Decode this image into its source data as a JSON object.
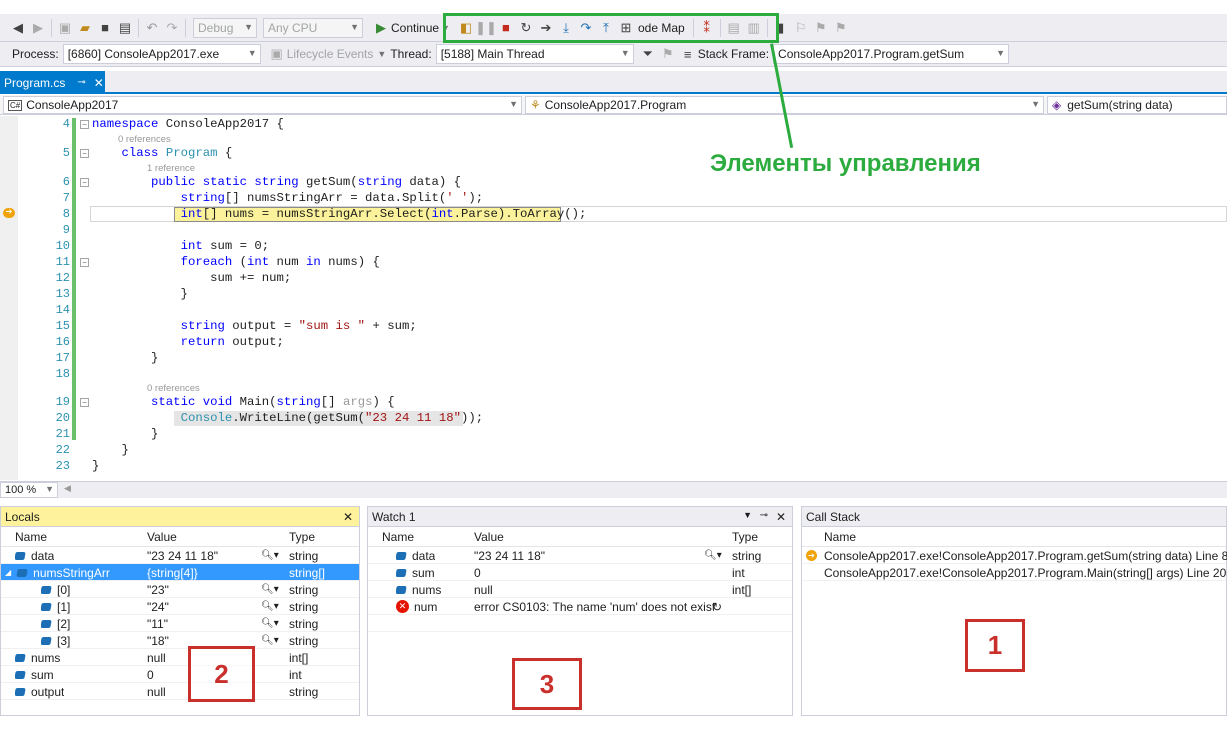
{
  "toolbar1": {
    "config": "Debug",
    "platform": "Any CPU",
    "continue_label": "Continue",
    "code_map_label": "ode Map"
  },
  "toolbar2": {
    "process_label": "Process:",
    "process_value": "[6860] ConsoleApp2017.exe",
    "lifecycle_label": "Lifecycle Events",
    "thread_label": "Thread:",
    "thread_value": "[5188] Main Thread",
    "stack_frame_label": "Stack Frame:",
    "stack_frame_value": "ConsoleApp2017.Program.getSum"
  },
  "tab": {
    "label": "Program.cs"
  },
  "navbar": {
    "project": "ConsoleApp2017",
    "class": "ConsoleApp2017.Program",
    "member": "getSum(string data)"
  },
  "editor": {
    "line_numbers": [
      "4",
      "5",
      "6",
      "7",
      "8",
      "9",
      "10",
      "11",
      "12",
      "13",
      "14",
      "15",
      "16",
      "17",
      "18",
      "19",
      "20",
      "21",
      "22",
      "23"
    ],
    "ref_0_refs_a": "0 references",
    "ref_1_ref": "1 reference",
    "ref_0_refs_b": "0 references"
  },
  "zoom": "100 %",
  "locals": {
    "title": "Locals",
    "headers": [
      "Name",
      "Value",
      "Type"
    ],
    "rows": [
      {
        "name": "data",
        "value": "\"23 24 11 18\"",
        "type": "string"
      },
      {
        "name": "numsStringArr",
        "value": "{string[4]}",
        "type": "string[]"
      },
      {
        "name": "[0]",
        "value": "\"23\"",
        "type": "string"
      },
      {
        "name": "[1]",
        "value": "\"24\"",
        "type": "string"
      },
      {
        "name": "[2]",
        "value": "\"11\"",
        "type": "string"
      },
      {
        "name": "[3]",
        "value": "\"18\"",
        "type": "string"
      },
      {
        "name": "nums",
        "value": "null",
        "type": "int[]"
      },
      {
        "name": "sum",
        "value": "0",
        "type": "int"
      },
      {
        "name": "output",
        "value": "null",
        "type": "string"
      }
    ]
  },
  "watch": {
    "title": "Watch 1",
    "headers": [
      "Name",
      "Value",
      "Type"
    ],
    "rows": [
      {
        "name": "data",
        "value": "\"23 24 11 18\"",
        "type": "string"
      },
      {
        "name": "sum",
        "value": "0",
        "type": "int"
      },
      {
        "name": "nums",
        "value": "null",
        "type": "int[]"
      },
      {
        "name": "num",
        "value": "error CS0103: The name 'num' does not exist",
        "type": ""
      }
    ]
  },
  "callstack": {
    "title": "Call Stack",
    "header": "Name",
    "rows": [
      "ConsoleApp2017.exe!ConsoleApp2017.Program.getSum(string data) Line 8",
      "ConsoleApp2017.exe!ConsoleApp2017.Program.Main(string[] args) Line 20"
    ]
  },
  "annotations": {
    "controls_label": "Элементы управления",
    "box1": "1",
    "box2": "2",
    "box3": "3",
    "green": "#2cab3e",
    "red": "#c9302c"
  }
}
